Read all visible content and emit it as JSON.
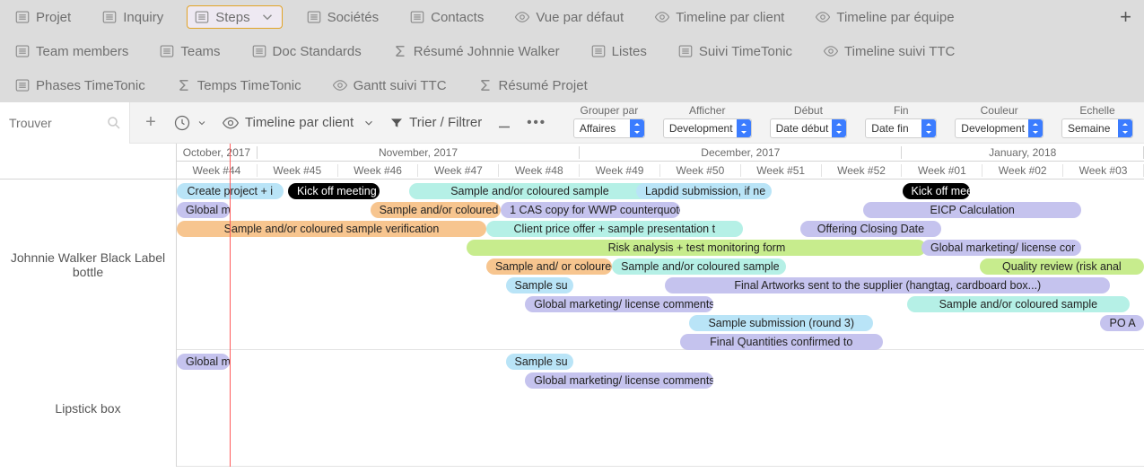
{
  "tabs": {
    "row1": [
      {
        "label": "Projet",
        "icon": "list",
        "active": false
      },
      {
        "label": "Inquiry",
        "icon": "list",
        "active": false
      },
      {
        "label": "Steps",
        "icon": "list",
        "active": true,
        "chev": true
      },
      {
        "label": "Sociétés",
        "icon": "list",
        "active": false
      },
      {
        "label": "Contacts",
        "icon": "list",
        "active": false
      },
      {
        "label": "Vue par défaut",
        "icon": "eye",
        "active": false
      },
      {
        "label": "Timeline par client",
        "icon": "eye",
        "active": false
      },
      {
        "label": "Timeline par équipe",
        "icon": "eye",
        "active": false
      }
    ],
    "row2": [
      {
        "label": "Team members",
        "icon": "list"
      },
      {
        "label": "Teams",
        "icon": "list"
      },
      {
        "label": "Doc Standards",
        "icon": "list"
      },
      {
        "label": "Résumé Johnnie Walker",
        "icon": "sigma"
      },
      {
        "label": "Listes",
        "icon": "list"
      },
      {
        "label": "Suivi TimeTonic",
        "icon": "list"
      },
      {
        "label": "Timeline suivi TTC",
        "icon": "eye"
      }
    ],
    "row3": [
      {
        "label": "Phases TimeTonic",
        "icon": "list"
      },
      {
        "label": "Temps TimeTonic",
        "icon": "sigma"
      },
      {
        "label": "Gantt suivi TTC",
        "icon": "eye"
      },
      {
        "label": "Résumé Projet",
        "icon": "sigma"
      }
    ]
  },
  "search": {
    "placeholder": "Trouver"
  },
  "toolbar": {
    "view_label": "Timeline par client",
    "sort_label": "Trier / Filtrer"
  },
  "selects": [
    {
      "label": "Grouper par",
      "value": "Affaires"
    },
    {
      "label": "Afficher",
      "value": "Development"
    },
    {
      "label": "Début",
      "value": "Date début"
    },
    {
      "label": "Fin",
      "value": "Date fin"
    },
    {
      "label": "Couleur",
      "value": "Development"
    },
    {
      "label": "Echelle",
      "value": "Semaine"
    }
  ],
  "timeline": {
    "months": [
      {
        "label": "October, 2017",
        "span": 1
      },
      {
        "label": "November, 2017",
        "span": 4
      },
      {
        "label": "December, 2017",
        "span": 4
      },
      {
        "label": "January, 2018",
        "span": 3
      }
    ],
    "weeks": [
      "Week #44",
      "Week #45",
      "Week #46",
      "Week #47",
      "Week #48",
      "Week #49",
      "Week #50",
      "Week #51",
      "Week #52",
      "Week #01",
      "Week #02",
      "Week #03"
    ],
    "today_week_fraction": 0.055
  },
  "lanes": [
    {
      "name": "Johnnie Walker Black Label bottle",
      "height": 190,
      "bars": [
        {
          "row": 0,
          "start": 0.0,
          "end": 0.11,
          "color": "blue",
          "text": "Create project + i"
        },
        {
          "row": 0,
          "start": 0.115,
          "end": 0.21,
          "color": "black",
          "text": "Kick off meeting"
        },
        {
          "row": 0,
          "start": 0.24,
          "end": 0.49,
          "color": "teal",
          "text": "Sample and/or coloured sample"
        },
        {
          "row": 0,
          "start": 0.475,
          "end": 0.615,
          "color": "blue",
          "text": "Lapdid submission, if ne"
        },
        {
          "row": 0,
          "start": 0.75,
          "end": 0.82,
          "color": "black",
          "text": "Kick off mee"
        },
        {
          "row": 1,
          "start": 0.0,
          "end": 0.055,
          "color": "purple",
          "text": "Global ma"
        },
        {
          "row": 1,
          "start": 0.2,
          "end": 0.335,
          "color": "orange",
          "text": "Sample and/or coloured"
        },
        {
          "row": 1,
          "start": 0.335,
          "end": 0.52,
          "color": "purple",
          "text": "1 CAS copy for WWP counterquote"
        },
        {
          "row": 1,
          "start": 0.71,
          "end": 0.935,
          "color": "purple",
          "text": "EICP Calculation"
        },
        {
          "row": 2,
          "start": 0.0,
          "end": 0.32,
          "color": "orange",
          "text": "Sample and/or coloured sample verification"
        },
        {
          "row": 2,
          "start": 0.32,
          "end": 0.585,
          "color": "teal",
          "text": "Client price offer + sample presentation t"
        },
        {
          "row": 2,
          "start": 0.645,
          "end": 0.79,
          "color": "purple",
          "text": "Offering Closing Date"
        },
        {
          "row": 3,
          "start": 0.3,
          "end": 0.775,
          "color": "green",
          "text": "Risk analysis + test monitoring form"
        },
        {
          "row": 3,
          "start": 0.77,
          "end": 0.935,
          "color": "purple",
          "text": "Global marketing/ license cor"
        },
        {
          "row": 4,
          "start": 0.32,
          "end": 0.45,
          "color": "orange",
          "text": "Sample and/ or coloured san"
        },
        {
          "row": 4,
          "start": 0.45,
          "end": 0.63,
          "color": "teal",
          "text": "Sample and/or coloured sample"
        },
        {
          "row": 4,
          "start": 0.83,
          "end": 1.0,
          "color": "green",
          "text": "Quality review (risk anal"
        },
        {
          "row": 5,
          "start": 0.34,
          "end": 0.41,
          "color": "blue",
          "text": "Sample su"
        },
        {
          "row": 5,
          "start": 0.505,
          "end": 0.965,
          "color": "purple",
          "text": "Final Artworks sent to the supplier (hangtag, cardboard box...)"
        },
        {
          "row": 6,
          "start": 0.36,
          "end": 0.555,
          "color": "purple",
          "text": "Global marketing/ license comments"
        },
        {
          "row": 6,
          "start": 0.755,
          "end": 0.985,
          "color": "teal",
          "text": "Sample and/or coloured sample"
        },
        {
          "row": 7,
          "start": 0.53,
          "end": 0.72,
          "color": "blue",
          "text": "Sample submission (round 3)"
        },
        {
          "row": 7,
          "start": 0.955,
          "end": 1.0,
          "color": "purple",
          "text": "PO A"
        },
        {
          "row": 8,
          "start": 0.52,
          "end": 0.73,
          "color": "purple",
          "text": "Final Quantities confirmed to"
        }
      ]
    },
    {
      "name": "Lipstick box",
      "height": 130,
      "bars": [
        {
          "row": 0,
          "start": 0.0,
          "end": 0.055,
          "color": "purple",
          "text": "Global ma"
        },
        {
          "row": 0,
          "start": 0.34,
          "end": 0.41,
          "color": "blue",
          "text": "Sample su"
        },
        {
          "row": 1,
          "start": 0.36,
          "end": 0.555,
          "color": "purple",
          "text": "Global marketing/ license comments"
        }
      ]
    }
  ]
}
